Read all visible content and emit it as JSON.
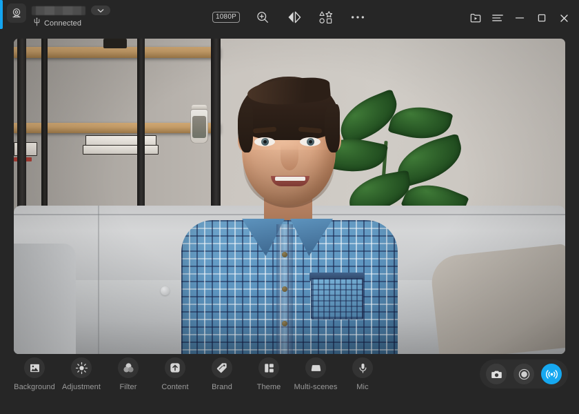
{
  "app": {
    "accent_color": "#14a5f0",
    "header_bg": "#262626",
    "panel_bg": "#333333"
  },
  "header": {
    "camera_icon": "webcam-icon",
    "device_name": "",
    "device_name_state": "redacted",
    "dropdown_icon": "chevron-down-icon",
    "usb_icon": "usb-icon",
    "status": "Connected",
    "tools": [
      {
        "name": "resolution-badge",
        "label": "1080P",
        "icon": "resolution-badge"
      },
      {
        "name": "zoom-in-button",
        "label": "Zoom",
        "icon": "magnifier-plus-icon"
      },
      {
        "name": "mirror-button",
        "label": "Mirror",
        "icon": "mirror-flip-icon"
      },
      {
        "name": "stickers-button",
        "label": "Stickers",
        "icon": "shapes-icon"
      },
      {
        "name": "more-button",
        "label": "More",
        "icon": "ellipsis-icon"
      }
    ],
    "window_controls": [
      {
        "name": "media-library-button",
        "label": "Media",
        "icon": "folder-play-icon"
      },
      {
        "name": "menu-button",
        "label": "Menu",
        "icon": "hamburger-icon"
      },
      {
        "name": "minimize-button",
        "label": "Minimize",
        "icon": "minimize-icon"
      },
      {
        "name": "maximize-button",
        "label": "Maximize",
        "icon": "maximize-icon"
      },
      {
        "name": "close-button",
        "label": "Close",
        "icon": "close-icon"
      }
    ]
  },
  "preview": {
    "alt": "Webcam preview: smiling man in blue plaid shirt seated on a grey sofa with a shelving unit and plant behind him"
  },
  "toolbar": {
    "items": [
      {
        "label": "Background",
        "icon": "image-icon"
      },
      {
        "label": "Adjustment",
        "icon": "brightness-icon"
      },
      {
        "label": "Filter",
        "icon": "filter-circles-icon"
      },
      {
        "label": "Content",
        "icon": "upload-arrow-icon"
      },
      {
        "label": "Brand",
        "icon": "tag-icon"
      },
      {
        "label": "Theme",
        "icon": "layout-blocks-icon"
      },
      {
        "label": "Multi-scenes",
        "icon": "scenes-card-icon"
      },
      {
        "label": "Mic",
        "icon": "microphone-icon"
      }
    ],
    "actions": [
      {
        "name": "snapshot-button",
        "label": "Snapshot",
        "icon": "camera-icon",
        "active": false
      },
      {
        "name": "record-button",
        "label": "Record",
        "icon": "record-circle-icon",
        "active": false
      },
      {
        "name": "broadcast-button",
        "label": "Broadcast",
        "icon": "broadcast-icon",
        "active": true
      }
    ]
  }
}
